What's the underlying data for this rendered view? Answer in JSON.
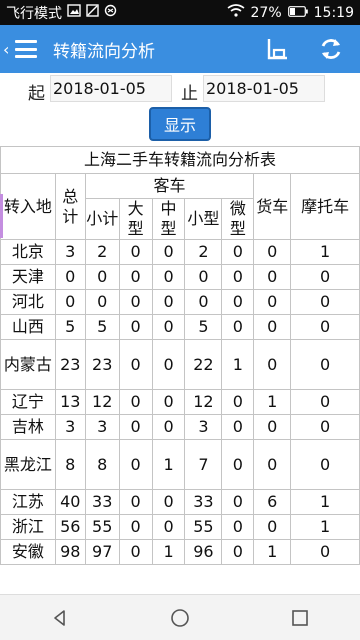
{
  "status_bar": {
    "mode": "飞行模式",
    "battery": "27%",
    "time": "15:19"
  },
  "app_bar": {
    "title": "转籍流向分析",
    "icons": [
      "back-icon",
      "menu-icon",
      "chart-icon",
      "refresh-icon"
    ]
  },
  "filter": {
    "from_label": "起",
    "from_value": "2018-01-05",
    "to_label": "止",
    "to_value": "2018-01-05",
    "show_button": "显示"
  },
  "report": {
    "title": "上海二手车转籍流向分析表",
    "headers": {
      "region": "转入地",
      "total": "总计",
      "passenger": "客车",
      "passenger_sub": [
        "小计",
        "大型",
        "中型",
        "小型",
        "微型"
      ],
      "truck": "货车",
      "motorcycle": "摩托车"
    },
    "rows": [
      {
        "region": "北京",
        "cells": [
          "3",
          "2",
          "0",
          "0",
          "2",
          "0",
          "0",
          "1"
        ]
      },
      {
        "region": "天津",
        "cells": [
          "0",
          "0",
          "0",
          "0",
          "0",
          "0",
          "0",
          "0"
        ]
      },
      {
        "region": "河北",
        "cells": [
          "0",
          "0",
          "0",
          "0",
          "0",
          "0",
          "0",
          "0"
        ]
      },
      {
        "region": "山西",
        "cells": [
          "5",
          "5",
          "0",
          "0",
          "5",
          "0",
          "0",
          "0"
        ]
      },
      {
        "region": "内蒙古",
        "cells": [
          "23",
          "23",
          "0",
          "0",
          "22",
          "1",
          "0",
          "0"
        ]
      },
      {
        "region": "辽宁",
        "cells": [
          "13",
          "12",
          "0",
          "0",
          "12",
          "0",
          "1",
          "0"
        ]
      },
      {
        "region": "吉林",
        "cells": [
          "3",
          "3",
          "0",
          "0",
          "3",
          "0",
          "0",
          "0"
        ]
      },
      {
        "region": "黑龙江",
        "cells": [
          "8",
          "8",
          "0",
          "1",
          "7",
          "0",
          "0",
          "0"
        ]
      },
      {
        "region": "江苏",
        "cells": [
          "40",
          "33",
          "0",
          "0",
          "33",
          "0",
          "6",
          "1"
        ]
      },
      {
        "region": "浙江",
        "cells": [
          "56",
          "55",
          "0",
          "0",
          "55",
          "0",
          "0",
          "1"
        ]
      },
      {
        "region": "安徽",
        "cells": [
          "98",
          "97",
          "0",
          "1",
          "96",
          "0",
          "1",
          "0"
        ]
      }
    ]
  },
  "nav_bar": {
    "icons": [
      "nav-back-icon",
      "nav-home-icon",
      "nav-recents-icon"
    ]
  }
}
